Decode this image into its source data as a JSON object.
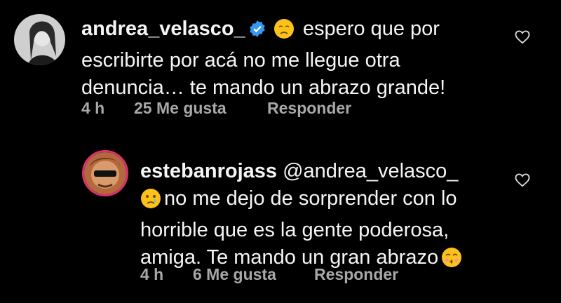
{
  "comments": [
    {
      "username": "andrea_velasco_",
      "verified": true,
      "emoji": "sad-face",
      "text": "espero que por escribirte por acá no me llegue otra denuncia… te mando un abrazo grande!",
      "line1": "espero que por",
      "line2": "escribirte por acá no me llegue otra",
      "line3": "denuncia… te mando un abrazo grande!",
      "time": "4 h",
      "likes": "25 Me gusta",
      "reply": "Responder"
    },
    {
      "username": "estebanrojass",
      "mention": "@andrea_velasco_",
      "emoji_start": "crying-face",
      "emoji_end": "kissing-face",
      "line1": "no me dejo de sorprender con lo",
      "line2": "horrible que es la gente poderosa,",
      "line3": "amiga. Te mando un  gran abrazo",
      "time": "4 h",
      "likes": "6 Me gusta",
      "reply": "Responder"
    }
  ],
  "colors": {
    "background": "#000000",
    "text": "#f5f5f5",
    "meta": "#a8a8a8",
    "verified": "#3897f0",
    "avatar_ring": "#d9306f"
  },
  "icons": [
    "verified-badge-icon",
    "sad-face-emoji",
    "crying-face-emoji",
    "kissing-face-emoji",
    "heart-icon"
  ]
}
